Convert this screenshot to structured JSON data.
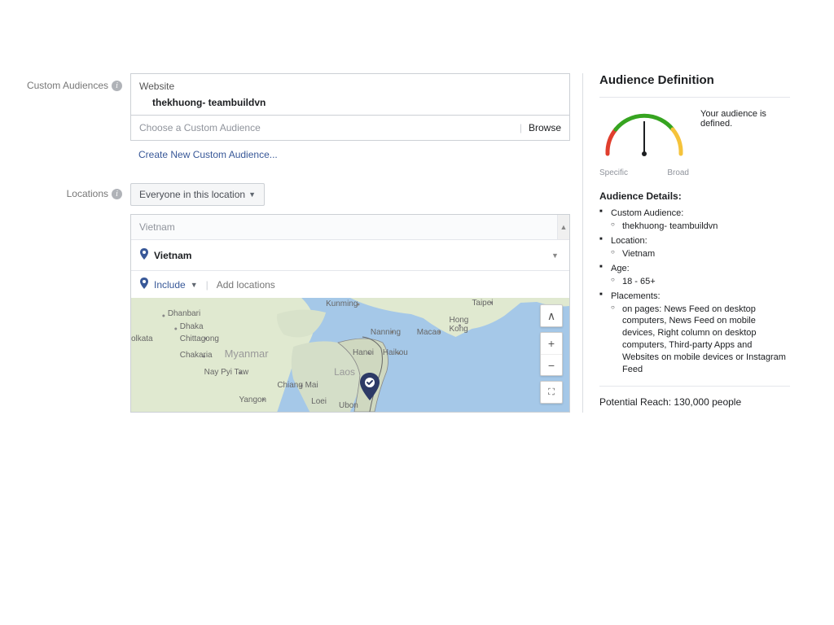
{
  "labels": {
    "custom_audiences": "Custom Audiences",
    "locations": "Locations"
  },
  "custom_audience": {
    "group": "Website",
    "selected": "thekhuong- teambuildvn",
    "choose_placeholder": "Choose a Custom Audience",
    "browse": "Browse",
    "create_link": "Create New Custom Audience..."
  },
  "location": {
    "scope": "Everyone in this location",
    "country_header": "Vietnam",
    "selected": "Vietnam",
    "include_label": "Include",
    "add_placeholder": "Add locations"
  },
  "map": {
    "labels": [
      "Dhanbari",
      "Dhaka",
      "olkata",
      "Chittagong",
      "Chakaria",
      "Nay Pyi Taw",
      "Yangon",
      "Chiang Mai",
      "Kunming",
      "Nanning",
      "Hanoi",
      "Haikou",
      "Macao",
      "Hong Kong",
      "Taipei",
      "Laos",
      "Loei",
      "Ubon",
      "Myanmar"
    ]
  },
  "right": {
    "title": "Audience Definition",
    "defined_text": "Your audience is defined.",
    "gauge_specific": "Specific",
    "gauge_broad": "Broad",
    "details_title": "Audience Details:",
    "items": {
      "ca_label": "Custom Audience:",
      "ca_value": "thekhuong- teambuildvn",
      "loc_label": "Location:",
      "loc_value": "Vietnam",
      "age_label": "Age:",
      "age_value": "18 - 65+",
      "place_label": "Placements:",
      "place_value": "on pages: News Feed on desktop computers, News Feed on mobile devices, Right column on desktop computers, Third-party Apps and Websites on mobile devices or Instagram Feed"
    },
    "reach": "Potential Reach: 130,000 people"
  }
}
